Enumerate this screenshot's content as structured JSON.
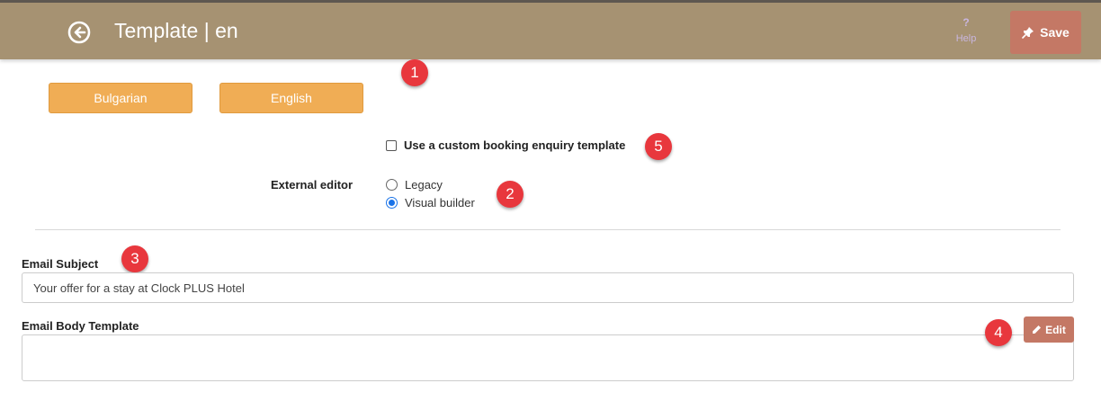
{
  "header": {
    "title": "Template | en",
    "help_symbol": "?",
    "help_label": "Help",
    "save_label": "Save"
  },
  "languages": [
    {
      "label": "Bulgarian"
    },
    {
      "label": "English"
    }
  ],
  "custom_template": {
    "label": "Use a custom booking enquiry template",
    "checked": false
  },
  "external_editor": {
    "label": "External editor",
    "options": [
      {
        "label": "Legacy",
        "selected": false
      },
      {
        "label": "Visual builder",
        "selected": true
      }
    ]
  },
  "email_subject": {
    "label": "Email Subject",
    "value": "Your offer for a stay at Clock PLUS Hotel"
  },
  "email_body": {
    "label": "Email Body Template",
    "edit_label": "Edit"
  },
  "markers": [
    "1",
    "2",
    "3",
    "4",
    "5"
  ],
  "colors": {
    "header_bg": "#a69272",
    "save_button": "#c47865",
    "language_button": "#f0ad55",
    "marker": "#e8373d",
    "radio_selected": "#1a73e8"
  }
}
